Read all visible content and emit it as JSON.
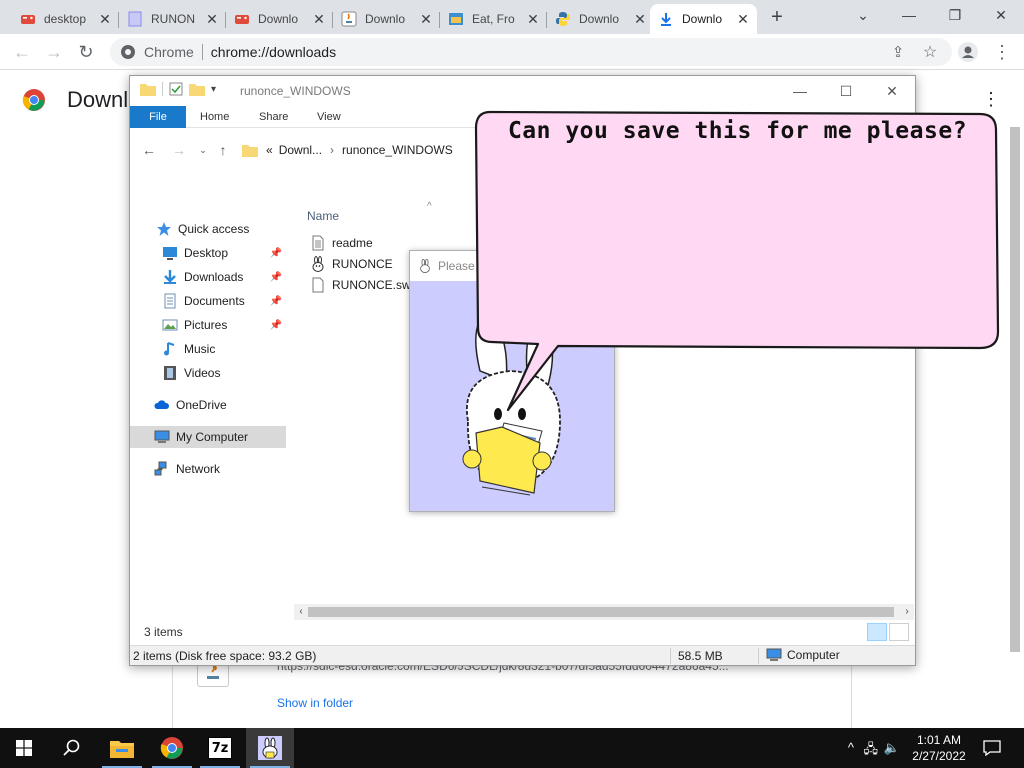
{
  "browser": {
    "tabs": [
      {
        "title": "desktop",
        "icon": "game-controller-icon",
        "color": "#e04a3b"
      },
      {
        "title": "RUNON",
        "icon": "flash-page-icon",
        "color": "#8a8af0"
      },
      {
        "title": "Downlo",
        "icon": "game-controller-icon",
        "color": "#e04a3b"
      },
      {
        "title": "Downlo",
        "icon": "java-icon",
        "color": "#6a6a6a"
      },
      {
        "title": "Eat, Fro",
        "icon": "storefront-icon",
        "color": "#3d8fd0"
      },
      {
        "title": "Downlo",
        "icon": "python-icon",
        "color": "#3572a5"
      },
      {
        "title": "Downlo",
        "icon": "download-icon",
        "color": "#1a73e8",
        "active": true
      }
    ],
    "omnibox": {
      "scheme_label": "Chrome",
      "url": "chrome://downloads"
    },
    "accent": "#1a73e8"
  },
  "downloads_page": {
    "title": "Downl",
    "item": {
      "url": "https://sdlc-esd.oracle.com/ESD6/JSCDL/jdk/8u321-b07/df5ad55fdd604472a86a45...",
      "show_in_folder": "Show in folder"
    }
  },
  "explorer": {
    "window_title": "runonce_WINDOWS",
    "ribbon_tabs": [
      "File",
      "Home",
      "Share",
      "View"
    ],
    "address": {
      "prefix": "«",
      "crumb1": "Downl...",
      "sep": "›",
      "crumb2": "runonce_WINDOWS"
    },
    "nav": [
      {
        "label": "Quick access",
        "icon": "star-icon",
        "pinned": false
      },
      {
        "label": "Desktop",
        "icon": "desktop-icon",
        "pinned": true
      },
      {
        "label": "Downloads",
        "icon": "download-arrow-icon",
        "pinned": true
      },
      {
        "label": "Documents",
        "icon": "documents-icon",
        "pinned": true
      },
      {
        "label": "Pictures",
        "icon": "pictures-icon",
        "pinned": true
      },
      {
        "label": "Music",
        "icon": "music-note-icon",
        "pinned": false
      },
      {
        "label": "Videos",
        "icon": "film-icon",
        "pinned": false
      },
      {
        "label": "OneDrive",
        "icon": "cloud-icon",
        "pinned": false
      },
      {
        "label": "My Computer",
        "icon": "computer-icon",
        "pinned": false,
        "selected": true
      },
      {
        "label": "Network",
        "icon": "network-icon",
        "pinned": false
      }
    ],
    "column_name": "Name",
    "files": [
      {
        "name": "readme",
        "icon": "text-file-icon"
      },
      {
        "name": "RUNONCE",
        "icon": "bunny-app-icon"
      },
      {
        "name": "RUNONCE.swf",
        "icon": "blank-file-icon"
      }
    ],
    "item_count": "3 items",
    "status": {
      "summary": "2 items (Disk free space: 93.2 GB)",
      "size": "58.5 MB",
      "location": "Computer"
    }
  },
  "popup": {
    "title": "Please",
    "stage_color": "#ccccff"
  },
  "bubble": {
    "text": "Can you save this for me please?",
    "fill": "#ffd8f4"
  },
  "taskbar": {
    "apps": [
      "start-icon",
      "search-icon",
      "file-explorer-icon",
      "chrome-icon",
      "7zip-icon",
      "bunny-app-icon"
    ],
    "sevenzip_label": "7z",
    "clock_time": "1:01 AM",
    "clock_date": "2/27/2022"
  }
}
